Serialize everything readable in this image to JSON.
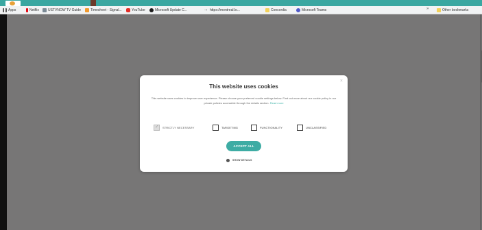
{
  "bookmarks": {
    "apps": "Apps",
    "netflix": "Netflix",
    "ustvnow": "USTVNOW TV Guide",
    "timesheet": "Timesheet - Signal...",
    "youtube": "YouTube",
    "msupdate": "Microsoft Update C...",
    "url": "https://montreal.lo...",
    "concordia": "Concordia",
    "teams": "Microsoft Teams",
    "close": "»",
    "other": "Other bookmarks"
  },
  "modal": {
    "close": "×",
    "title": "This website uses cookies",
    "description": "This website uses cookies to improve user experience. Please choose your preferred cookie settings below. Find out more about our cookie policy in our private policies accessible through the details section.",
    "read_more": "Read more",
    "options": [
      {
        "label": "STRICTLY NECESSARY",
        "checked": true
      },
      {
        "label": "TARGETING",
        "checked": false
      },
      {
        "label": "FUNCTIONALITY",
        "checked": false
      },
      {
        "label": "UNCLASSIFIED",
        "checked": false
      }
    ],
    "accept_label": "ACCEPT ALL",
    "show_details": "SHOW DETAILS"
  },
  "colors": {
    "accent": "#3eaca4",
    "overlay": "#777676",
    "top_strip": "#3aa7a1"
  },
  "icons": {
    "apps": "apps-grid-icon",
    "netflix": "netflix-icon",
    "ustvnow": "ustvnow-icon",
    "timesheet": "timesheet-icon",
    "youtube": "youtube-icon",
    "msupdate": "microsoft-update-icon",
    "concordia": "folder-icon",
    "teams": "teams-icon",
    "other": "folder-icon",
    "show_details": "gear-icon"
  }
}
